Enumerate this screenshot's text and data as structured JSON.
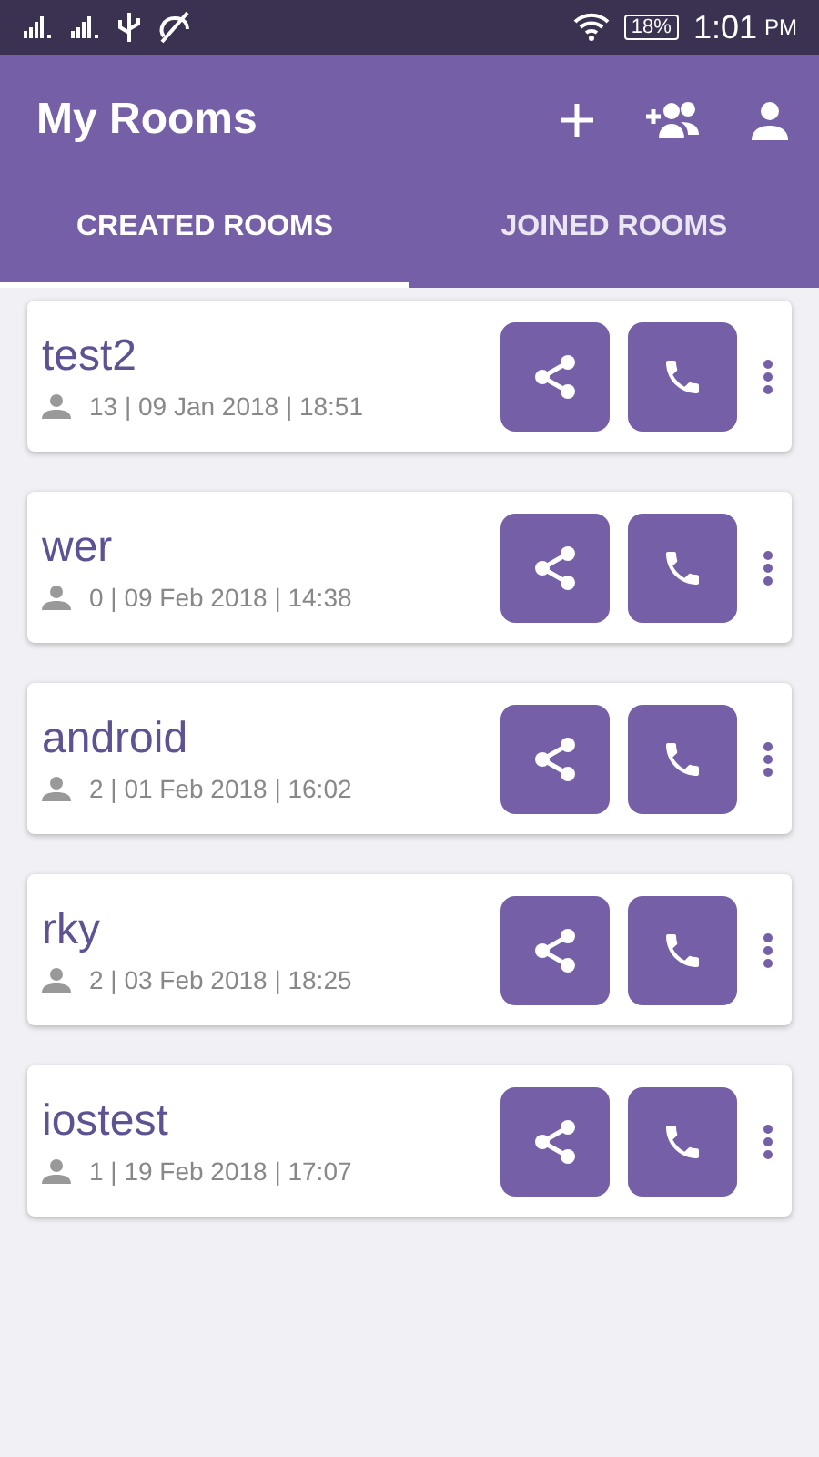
{
  "status_bar": {
    "battery": "18%",
    "time": "1:01",
    "meridiem": "PM"
  },
  "app_bar": {
    "title": "My Rooms"
  },
  "tabs": [
    {
      "label": "CREATED ROOMS",
      "selected": true
    },
    {
      "label": "JOINED ROOMS",
      "selected": false
    }
  ],
  "rooms": [
    {
      "name": "test2",
      "info": "13 | 09 Jan 2018 | 18:51"
    },
    {
      "name": "wer",
      "info": "0 | 09 Feb 2018 | 14:38"
    },
    {
      "name": "android",
      "info": "2 | 01 Feb 2018 | 16:02"
    },
    {
      "name": "rky",
      "info": "2 | 03 Feb 2018 | 18:25"
    },
    {
      "name": "iostest",
      "info": "1 | 19 Feb 2018 | 17:07"
    }
  ]
}
